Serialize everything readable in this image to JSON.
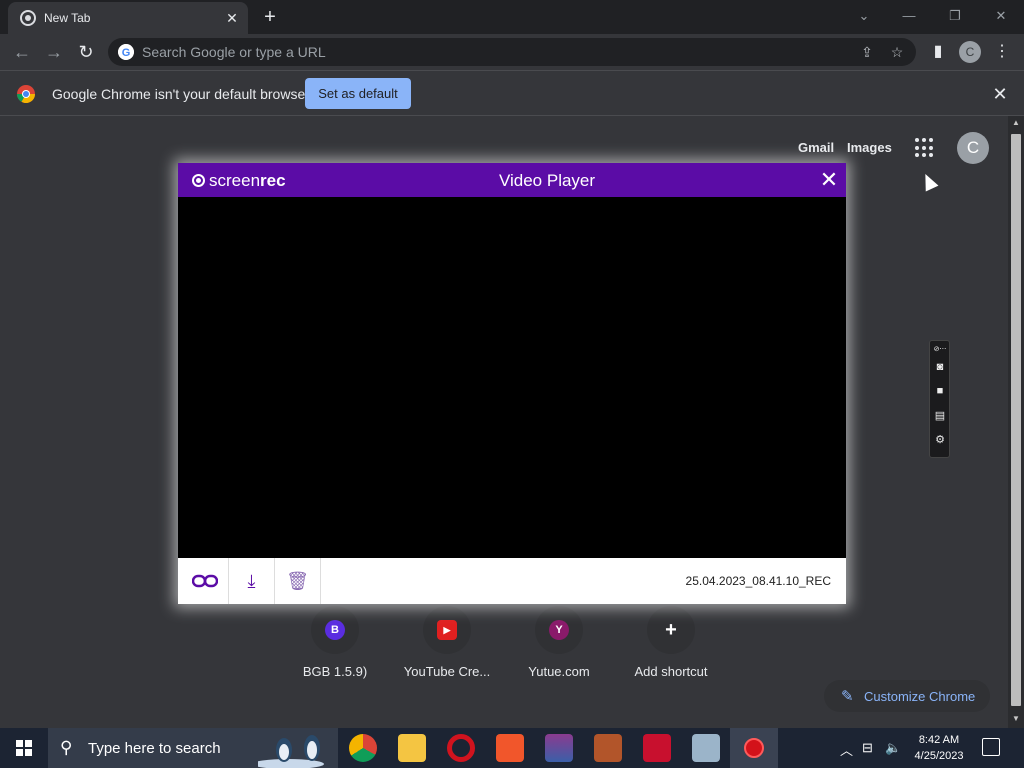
{
  "browser": {
    "tab": {
      "title": "New Tab",
      "close": "✕"
    },
    "new_tab": "+",
    "window_controls": [
      "⌄",
      "—",
      "❐",
      "✕"
    ],
    "nav": {
      "back": "←",
      "forward": "→",
      "reload": "↻"
    },
    "omnibox": {
      "placeholder": "Search Google or type a URL"
    },
    "profile_initial": "C"
  },
  "infobar": {
    "message": "Google Chrome isn't your default browser",
    "button": "Set as default",
    "close": "✕"
  },
  "ntp": {
    "links": {
      "gmail": "Gmail",
      "images": "Images"
    },
    "avatar": "C",
    "shortcuts": [
      {
        "label": "BGB 1.5.9)",
        "initial": "B",
        "color": "#5a2de0"
      },
      {
        "label": "YouTube Cre...",
        "initial": "▶",
        "color": "#e02020"
      },
      {
        "label": "Yutue.com",
        "initial": "Y",
        "color": "#8a1a6a"
      },
      {
        "label": "Add shortcut",
        "initial": "+",
        "color": "#303134"
      }
    ],
    "customize": "Customize Chrome"
  },
  "player": {
    "brand_light": "screen",
    "brand_bold": "rec",
    "title": "Video Player",
    "close": "✕",
    "filename": "25.04.2023_08.41.10_REC",
    "actions": {
      "link": "link-icon",
      "download": "download-icon",
      "delete": "trash-icon"
    }
  },
  "taskbar": {
    "search_placeholder": "Type here to search",
    "time": "8:42 AM",
    "date": "4/25/2023",
    "apps": [
      {
        "name": "chrome",
        "color": "#e8453c"
      },
      {
        "name": "file-explorer",
        "color": "#f4c542"
      },
      {
        "name": "opera",
        "color": "#d0131e"
      },
      {
        "name": "brave",
        "color": "#f1562b"
      },
      {
        "name": "winrar",
        "color": "#8a3b8f"
      },
      {
        "name": "game",
        "color": "#b2552a"
      },
      {
        "name": "flash",
        "color": "#c8102e"
      },
      {
        "name": "paint",
        "color": "#9bb4c9"
      },
      {
        "name": "screenrec",
        "color": "#d3121a"
      }
    ]
  }
}
